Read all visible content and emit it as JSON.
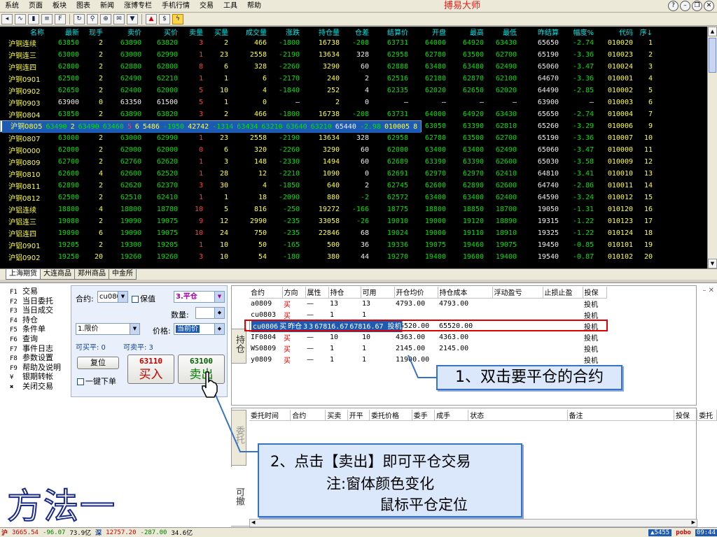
{
  "menu": {
    "items": [
      "系统",
      "页面",
      "板块",
      "图表",
      "新闻",
      "涨博专栏",
      "手机行情",
      "交易",
      "工具",
      "帮助"
    ],
    "app_title": "搏易大师"
  },
  "toolbar": {
    "icons": [
      "back-icon",
      "line-chart-icon",
      "candle-chart-icon",
      "list-icon",
      "f10-icon",
      "refresh-icon",
      "search-icon",
      "zoom-icon",
      "news-icon",
      "filter-icon",
      "alarm-icon",
      "trade-icon",
      "lightning-icon"
    ]
  },
  "quote": {
    "headers": [
      "名称",
      "最新",
      "现手",
      "卖价",
      "买价",
      "卖量",
      "买量",
      "成交量",
      "涨跌",
      "持仓量",
      "仓差",
      "结算价",
      "开盘",
      "最高",
      "最低",
      "昨结算",
      "幅度%",
      "代码",
      "序↓"
    ],
    "rows": [
      [
        "沪铜连续",
        "63850",
        "2",
        "63890",
        "63820",
        "3",
        "2",
        "466",
        "-1800",
        "16738",
        "-208",
        "63731",
        "64000",
        "64920",
        "63430",
        "65650",
        "-2.74",
        "010020",
        "1"
      ],
      [
        "沪铜连三",
        "63000",
        "2",
        "63000",
        "62990",
        "1",
        "23",
        "2558",
        "-2190",
        "13634",
        "328",
        "62958",
        "62780",
        "63500",
        "62700",
        "65190",
        "-3.36",
        "010023",
        "2"
      ],
      [
        "沪铜连四",
        "62800",
        "2",
        "62880",
        "62800",
        "8",
        "6",
        "328",
        "-2260",
        "3290",
        "60",
        "62888",
        "63480",
        "63480",
        "62490",
        "65060",
        "-3.47",
        "010024",
        "3"
      ],
      [
        "沪铜0901",
        "62500",
        "2",
        "62490",
        "62210",
        "1",
        "1",
        "6",
        "-2170",
        "240",
        "2",
        "62516",
        "62180",
        "62870",
        "62100",
        "64670",
        "-3.36",
        "010001",
        "4"
      ],
      [
        "沪铜0902",
        "62650",
        "2",
        "62400",
        "62000",
        "5",
        "10",
        "4",
        "-1840",
        "252",
        "4",
        "62335",
        "62020",
        "62650",
        "62020",
        "64490",
        "-2.85",
        "010002",
        "5"
      ],
      [
        "沪铜0903",
        "63900",
        "0",
        "63350",
        "61500",
        "5",
        "1",
        "0",
        "—",
        "2",
        "0",
        "—",
        "—",
        "—",
        "—",
        "63900",
        "—",
        "010003",
        "6"
      ],
      [
        "沪铜0804",
        "63850",
        "2",
        "63890",
        "63820",
        "3",
        "2",
        "466",
        "-1800",
        "16738",
        "-208",
        "63731",
        "64000",
        "64920",
        "63430",
        "65650",
        "-2.74",
        "010004",
        "7"
      ],
      [
        "沪铜0805",
        "63490",
        "2",
        "63490",
        "63460",
        "5",
        "6",
        "5486",
        "-1950",
        "42742",
        "-1314",
        "63434",
        "63210",
        "63640",
        "63210",
        "65440",
        "-2.98",
        "010005",
        "8"
      ],
      [
        "沪铜0806",
        "63110",
        "4",
        "63110",
        "63100",
        "22",
        "9",
        "50044",
        "-2150",
        "82162",
        "6020",
        "63097",
        "63050",
        "63390",
        "62810",
        "65260",
        "-3.29",
        "010006",
        "9"
      ],
      [
        "沪铜0807",
        "63000",
        "2",
        "63000",
        "62990",
        "1",
        "23",
        "2558",
        "-2190",
        "13634",
        "328",
        "62958",
        "62780",
        "63500",
        "62700",
        "65190",
        "-3.36",
        "010007",
        "10"
      ],
      [
        "沪铜0000",
        "62000",
        "2",
        "62000",
        "62000",
        "0",
        "6",
        "320",
        "-2260",
        "3290",
        "60",
        "62000",
        "63400",
        "63400",
        "62490",
        "65060",
        "-3.47",
        "010000",
        "11"
      ],
      [
        "沪铜0809",
        "62700",
        "2",
        "62760",
        "62620",
        "1",
        "3",
        "148",
        "-2330",
        "1494",
        "60",
        "62689",
        "63390",
        "63390",
        "62600",
        "65030",
        "-3.58",
        "010009",
        "12"
      ],
      [
        "沪铜0810",
        "62600",
        "4",
        "62600",
        "62520",
        "1",
        "28",
        "12",
        "-2210",
        "1090",
        "0",
        "62691",
        "62970",
        "62970",
        "62410",
        "64810",
        "-3.41",
        "010010",
        "13"
      ],
      [
        "沪铜0811",
        "62890",
        "2",
        "62620",
        "62370",
        "3",
        "30",
        "4",
        "-1850",
        "640",
        "2",
        "62745",
        "62600",
        "62890",
        "62600",
        "64740",
        "-2.86",
        "010011",
        "14"
      ],
      [
        "沪铜0812",
        "62500",
        "2",
        "62510",
        "62410",
        "1",
        "1",
        "18",
        "-2090",
        "880",
        "-2",
        "62572",
        "63400",
        "63400",
        "62400",
        "64590",
        "-3.24",
        "010012",
        "15"
      ],
      [
        "沪铝连续",
        "18800",
        "4",
        "18800",
        "18780",
        "10",
        "5",
        "816",
        "-250",
        "19272",
        "-166",
        "18775",
        "18800",
        "18850",
        "18700",
        "19050",
        "-1.31",
        "010120",
        "16"
      ],
      [
        "沪铝连三",
        "19080",
        "2",
        "19090",
        "19075",
        "9",
        "12",
        "2990",
        "-235",
        "33058",
        "-26",
        "19010",
        "19000",
        "19120",
        "18890",
        "19315",
        "-1.22",
        "010123",
        "17"
      ],
      [
        "沪铝连四",
        "19090",
        "6",
        "19090",
        "19075",
        "10",
        "24",
        "750",
        "-235",
        "22846",
        "68",
        "19024",
        "19000",
        "19110",
        "18910",
        "19325",
        "-1.22",
        "010124",
        "18"
      ],
      [
        "沪铝0901",
        "19205",
        "2",
        "19300",
        "19205",
        "1",
        "10",
        "50",
        "-165",
        "500",
        "36",
        "19336",
        "19075",
        "19460",
        "19075",
        "19450",
        "-0.85",
        "010101",
        "19"
      ],
      [
        "沪铝0902",
        "19250",
        "20",
        "19260",
        "19260",
        "3",
        "10",
        "54",
        "-180",
        "380",
        "44",
        "19270",
        "19400",
        "19600",
        "19400",
        "19540",
        "-0.87",
        "010102",
        "20"
      ]
    ],
    "selected_row": 7
  },
  "market_tabs": [
    "上海期货",
    "大连商品",
    "郑州商品",
    "中金所"
  ],
  "fkeys": [
    {
      "key": "F1",
      "label": "交易"
    },
    {
      "key": "F2",
      "label": "当日委托"
    },
    {
      "key": "F3",
      "label": "当日成交"
    },
    {
      "key": "F4",
      "label": "持仓"
    },
    {
      "key": "F5",
      "label": "条件单"
    },
    {
      "key": "F6",
      "label": "查询"
    },
    {
      "key": "F7",
      "label": "事件日志"
    },
    {
      "key": "F8",
      "label": "参数设置"
    },
    {
      "key": "F9",
      "label": "帮助及说明"
    },
    {
      "key": "¥",
      "label": "银期转帐"
    },
    {
      "key": "✖",
      "label": "关闭交易"
    }
  ],
  "order": {
    "contract_label": "合约:",
    "contract_value": "cu0806",
    "hedge_label": "保值",
    "offset_value": "3.平仓",
    "qty_label": "数量:",
    "price_type": "1.限价",
    "price_label": "价格:",
    "price_value": "当前价",
    "can_buy_close": "可买平: 0",
    "can_sell_close": "可卖平: 3",
    "reset": "复位",
    "one_key": "一键下单",
    "buy_price": "63110",
    "buy_label": "买入",
    "sell_price": "63100",
    "sell_label": "卖出"
  },
  "holdings": {
    "side_tab": "持仓",
    "headers": [
      "合约",
      "方向",
      "属性",
      "持仓",
      "可用",
      "开仓均价",
      "持仓成本",
      "浮动盈亏",
      "止损止盈",
      "投保"
    ],
    "rows": [
      [
        "a0809",
        "买",
        "—",
        "13",
        "13",
        "4793.00",
        "4793.00",
        "",
        "",
        "投机"
      ],
      [
        "cu0803",
        "买",
        "—",
        "1",
        "1",
        "",
        "",
        "",
        "",
        "投机"
      ],
      [
        "cu0806",
        "买",
        "昨仓",
        "3",
        "3",
        "67816.67",
        "67816.67",
        "",
        "",
        "投机"
      ],
      [
        "cu0809",
        "买",
        "昨仓",
        "1",
        "1",
        "65520.00",
        "65520.00",
        "",
        "",
        "投机"
      ],
      [
        "IF0804",
        "买",
        "—",
        "10",
        "10",
        "4363.00",
        "4363.00",
        "",
        "",
        "投机"
      ],
      [
        "WS0809",
        "买",
        "—",
        "1",
        "1",
        "2145.00",
        "2145.00",
        "",
        "",
        "投机"
      ],
      [
        "y0809",
        "买",
        "—",
        "1",
        "1",
        "11900.00",
        "",
        "",
        "",
        "投机"
      ]
    ],
    "selected_row": 2
  },
  "orders": {
    "side_tab_1": "委托",
    "side_tab_2": "可撤",
    "headers": [
      "委托时间",
      "合约",
      "买卖",
      "开平",
      "委托价格",
      "委手",
      "成手",
      "状态",
      "备注",
      "投保",
      "委托"
    ]
  },
  "annotations": {
    "step1": "1、双击要平仓的合约",
    "step2_line1": "2、点击【卖出】即可平仓交易",
    "step2_line2": "注:窗体颜色变化",
    "step2_line3": "鼠标平仓定位",
    "method": "方法一"
  },
  "status": {
    "sh_label": "沪",
    "sh_index": "3665.54",
    "sh_change": "-96.07",
    "sh_amount": "73.9亿",
    "sz_label": "深",
    "sz_index": "12757.20",
    "sz_change": "-287.00",
    "sz_amount": "34.6亿",
    "alert": "▲5455",
    "brand": "pobo",
    "time": "09:44"
  },
  "colors": {
    "selected_row": "#1d5ab4",
    "quote_bg": "#000000",
    "quote_header": "#00e7e7",
    "name_yellow": "#ffff40",
    "up_red": "#ff4040",
    "down_green": "#00e000",
    "annotation_border": "#3872c8",
    "highlight_box": "#e00000"
  }
}
